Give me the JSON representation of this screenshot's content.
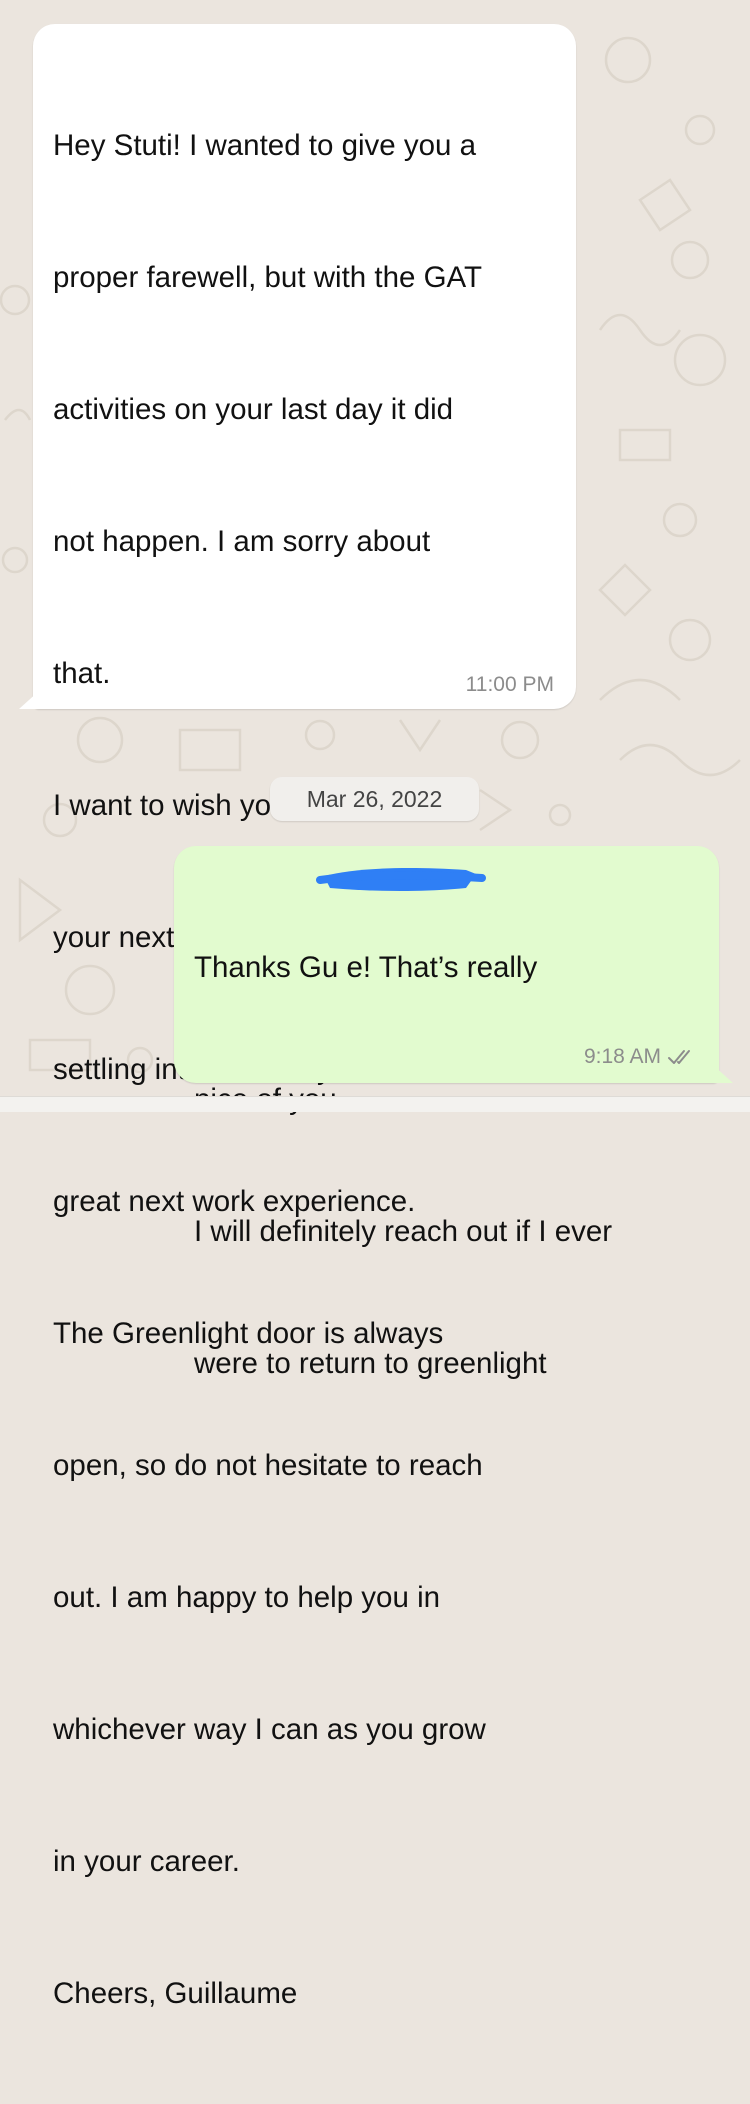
{
  "chat": {
    "messages": [
      {
        "direction": "incoming",
        "lines": [
          "Hey Stuti! I wanted to give you a",
          "proper farewell, but with the GAT",
          "activities on your last day it did",
          "not happen. I am sorry about",
          "that.",
          "I want to wish you all the best in",
          "your next adventure(s), good",
          "settling into Germany and a",
          "great next work experience.",
          "The Greenlight door is always",
          "open, so do not hesitate to reach",
          "out. I am happy to help you in",
          "whichever way I can as you grow",
          "in your career.",
          "Cheers, Guillaume"
        ],
        "time": "11:00 PM"
      },
      {
        "direction": "outgoing",
        "lines": [
          "Thanks Gu            e! That’s really",
          "nice of you.",
          "I will definitely reach out if I ever",
          "were to return to greenlight"
        ],
        "time": "9:18 AM",
        "status": "read"
      }
    ],
    "date_separator": "Mar 26, 2022"
  },
  "icons": {
    "read_receipt": "double-check-icon",
    "redaction": "redaction-scribble"
  },
  "colors": {
    "background": "#ebe5de",
    "incoming_bubble": "#ffffff",
    "outgoing_bubble": "#e2fbcf",
    "timestamp": "#8c8c8c",
    "redaction": "#2f7ff5"
  }
}
